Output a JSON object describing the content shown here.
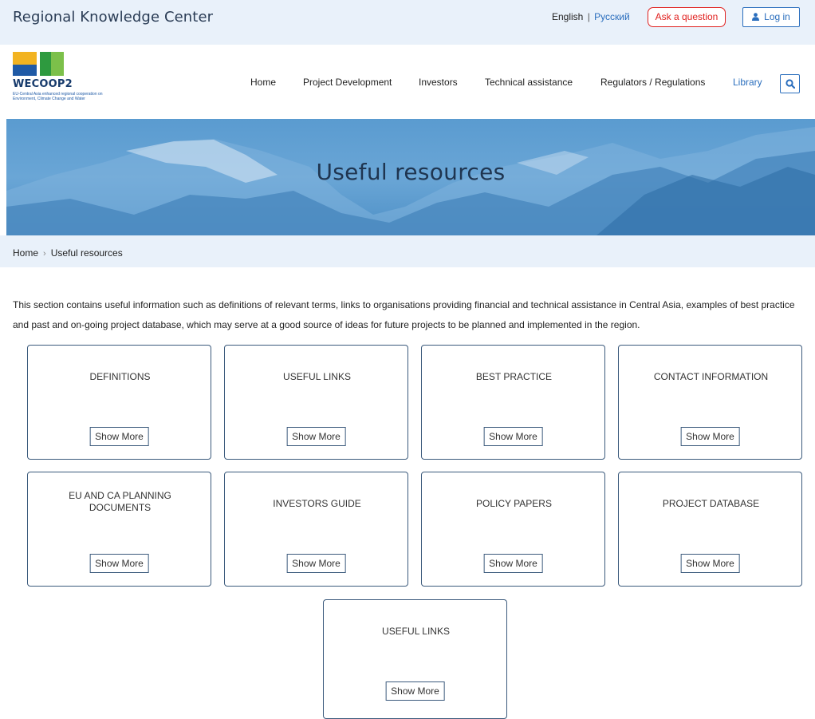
{
  "header": {
    "site_title": "Regional Knowledge Center",
    "lang_en": "English",
    "lang_sep": "|",
    "lang_ru": "Русский",
    "ask_label": "Ask a question",
    "login_label": "Log in"
  },
  "logo": {
    "name": "WECOOP2",
    "subtitle_line1": "EU-Central Asia enhanced regional cooperation on",
    "subtitle_line2": "Environment, Climate Change and Water"
  },
  "nav": {
    "items": [
      "Home",
      "Project Development",
      "Investors",
      "Technical assistance",
      "Regulators / Regulations",
      "Library"
    ],
    "active": "Library",
    "search_icon": "search-icon"
  },
  "hero": {
    "title": "Useful resources"
  },
  "breadcrumb": {
    "home": "Home",
    "separator": "›",
    "current": "Useful resources"
  },
  "intro": {
    "text": "This section contains useful information such as definitions of relevant terms, links to organisations providing financial and technical assistance in Central Asia, examples of best practice and past and on-going project database, which may serve at a good source of ideas for future projects to be planned and implemented in the region."
  },
  "cards": [
    {
      "title": "DEFINITIONS",
      "button": "Show More"
    },
    {
      "title": "USEFUL LINKS",
      "button": "Show More"
    },
    {
      "title": "BEST PRACTICE",
      "button": "Show More"
    },
    {
      "title": "CONTACT INFORMATION",
      "button": "Show More"
    },
    {
      "title": "EU AND CA PLANNING DOCUMENTS",
      "button": "Show More"
    },
    {
      "title": "INVESTORS GUIDE",
      "button": "Show More"
    },
    {
      "title": "POLICY PAPERS",
      "button": "Show More"
    },
    {
      "title": "PROJECT DATABASE",
      "button": "Show More"
    },
    {
      "title": "USEFUL LINKS",
      "button": "Show More"
    }
  ],
  "colors": {
    "accent": "#2a6ebd",
    "ask_red": "#e0211f",
    "header_bg": "#e9f1fa",
    "card_border": "#3b5a7c"
  }
}
